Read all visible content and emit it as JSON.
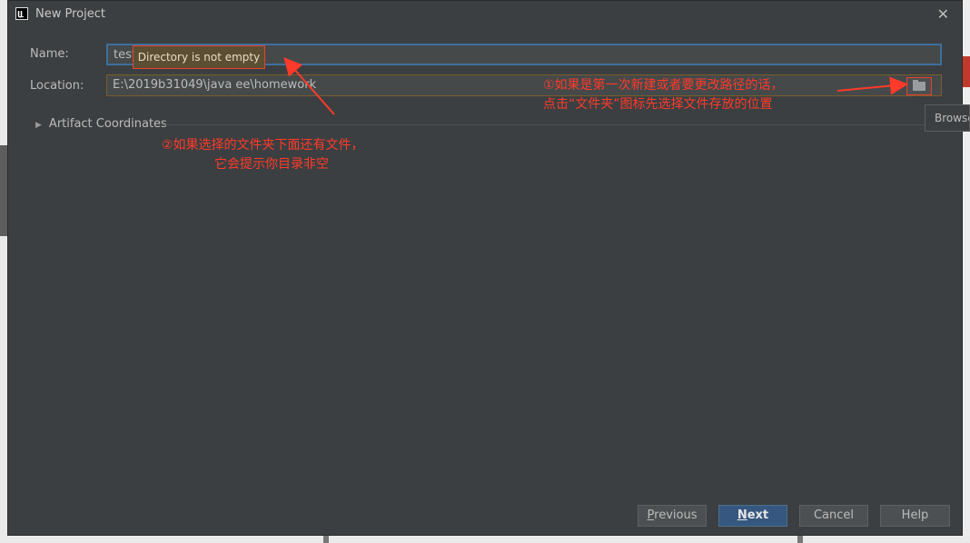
{
  "window": {
    "title": "New Project",
    "icon": "intellij-icon",
    "close_glyph": "✕"
  },
  "form": {
    "name_label": "Name:",
    "name_value": "test",
    "location_label": "Location:",
    "location_value": "E:\\2019b31049\\java ee\\homework",
    "tooltip": "Directory is not empty",
    "browse_tooltip": "Browse"
  },
  "section": {
    "artifact_label": "Artifact Coordinates"
  },
  "annotations": {
    "note1_line1": "①如果是第一次新建或者要更改路径的话，",
    "note1_line2": "点击“文件夹”图标先选择文件存放的位置",
    "note2_line1": "②如果选择的文件夹下面还有文件，",
    "note2_line2": "它会提示你目录非空",
    "color": "#ff3a2a"
  },
  "buttons": {
    "previous_rest": "revious",
    "previous_mnemonic": "P",
    "next_rest": "ext",
    "next_mnemonic": "N",
    "cancel": "Cancel",
    "help": "Help"
  },
  "colors": {
    "dialog_bg": "#3c3f41",
    "accent": "#365880",
    "annotation": "#ff3a2a"
  }
}
